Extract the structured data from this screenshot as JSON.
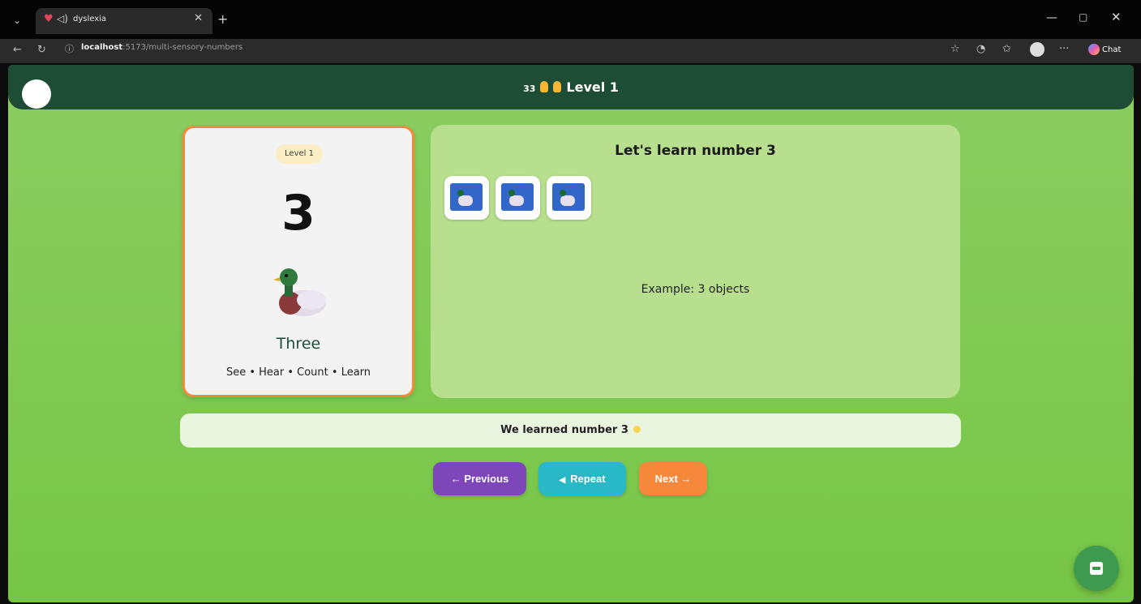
{
  "browser": {
    "tab_title": "dyslexia",
    "url_host": "localhost",
    "url_rest": ":5173/multi-sensory-numbers",
    "chat_label": "Chat"
  },
  "header": {
    "badge": "33",
    "title": "Level 1"
  },
  "card": {
    "level": "Level 1",
    "number": "3",
    "word": "Three",
    "senses": "See • Hear • Count • Learn",
    "image_icon": "duck-icon"
  },
  "panel": {
    "title": "Let's learn number 3",
    "objects": [
      "duck-icon",
      "duck-icon",
      "duck-icon"
    ],
    "example": "Example: 3 objects"
  },
  "message": {
    "text": "We learned number 3"
  },
  "buttons": {
    "previous": "← Previous",
    "repeat": "Repeat",
    "next": "Next →"
  },
  "colors": {
    "header_bg": "#1e4d35",
    "card_border": "#f28a3a",
    "prev": "#7d46b9",
    "repeat": "#28b8c6",
    "next": "#f5883a"
  }
}
